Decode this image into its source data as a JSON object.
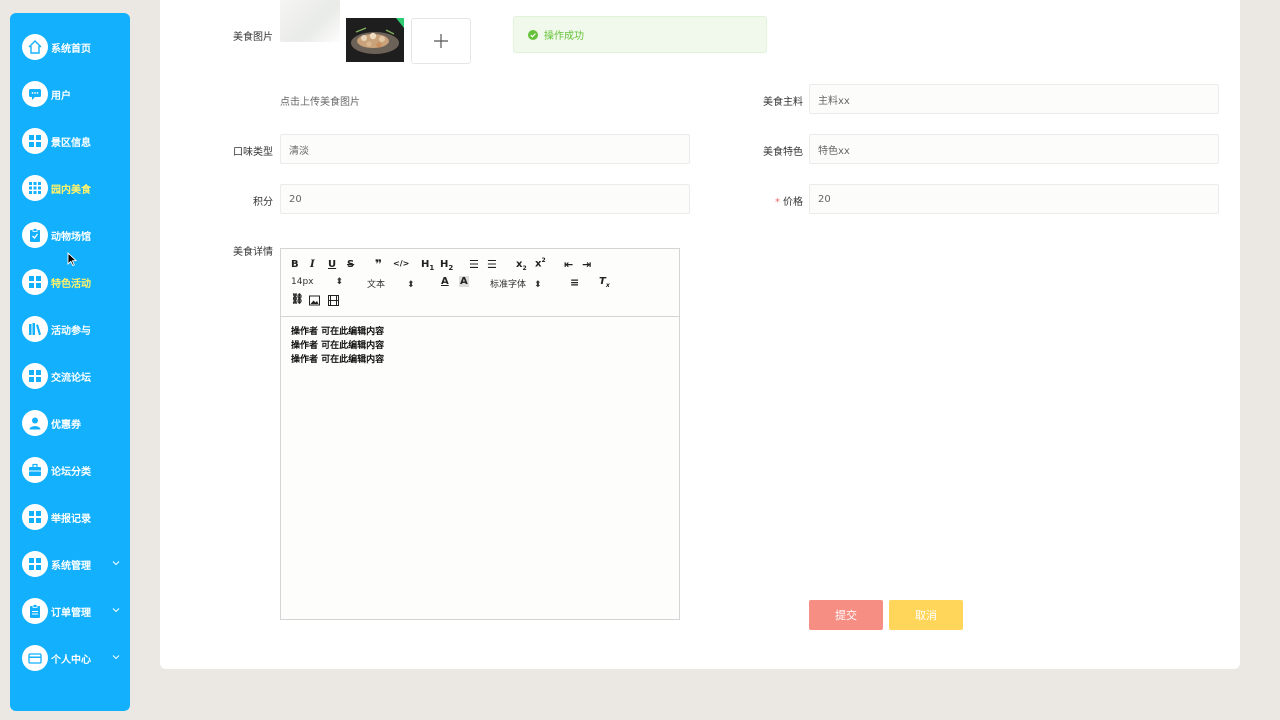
{
  "sidebar": {
    "items": [
      {
        "label": "系统首页",
        "icon": "home-icon"
      },
      {
        "label": "用户",
        "icon": "chat-icon"
      },
      {
        "label": "景区信息",
        "icon": "grid-icon"
      },
      {
        "label": "园内美食",
        "icon": "apps-icon"
      },
      {
        "label": "动物场馆",
        "icon": "clipboard-check-icon"
      },
      {
        "label": "特色活动",
        "icon": "grid-icon"
      },
      {
        "label": "活动参与",
        "icon": "books-icon"
      },
      {
        "label": "交流论坛",
        "icon": "grid-icon"
      },
      {
        "label": "优惠券",
        "icon": "user-icon"
      },
      {
        "label": "论坛分类",
        "icon": "briefcase-icon"
      },
      {
        "label": "举报记录",
        "icon": "grid-icon"
      },
      {
        "label": "系统管理",
        "icon": "grid-icon"
      },
      {
        "label": "订单管理",
        "icon": "clipboard-icon"
      },
      {
        "label": "个人中心",
        "icon": "card-icon"
      }
    ]
  },
  "form": {
    "image_label": "美食图片",
    "upload_hint": "点击上传美食图片",
    "main_ingredient_label": "美食主料",
    "main_ingredient_value": "主料xx",
    "flavor_label": "口味类型",
    "flavor_value": "清淡",
    "feature_label": "美食特色",
    "feature_value": "特色xx",
    "points_label": "积分",
    "points_value": "20",
    "price_label": "价格",
    "price_required": "*",
    "price_value": "20",
    "detail_label": "美食详情"
  },
  "toast": {
    "text": "操作成功",
    "color": "#67c23a"
  },
  "editor": {
    "font_size": "14px",
    "header_select": "文本",
    "font_family": "标准字体",
    "lines": [
      "操作者 可在此编辑内容",
      "操作者 可在此编辑内容",
      "操作者 可在此编辑内容"
    ]
  },
  "buttons": {
    "submit": "提交",
    "cancel": "取消"
  },
  "colors": {
    "sidebar": "#12b0fd",
    "active_label": "#fff36a",
    "submit": "#f78e84",
    "cancel": "#ffd55a"
  }
}
